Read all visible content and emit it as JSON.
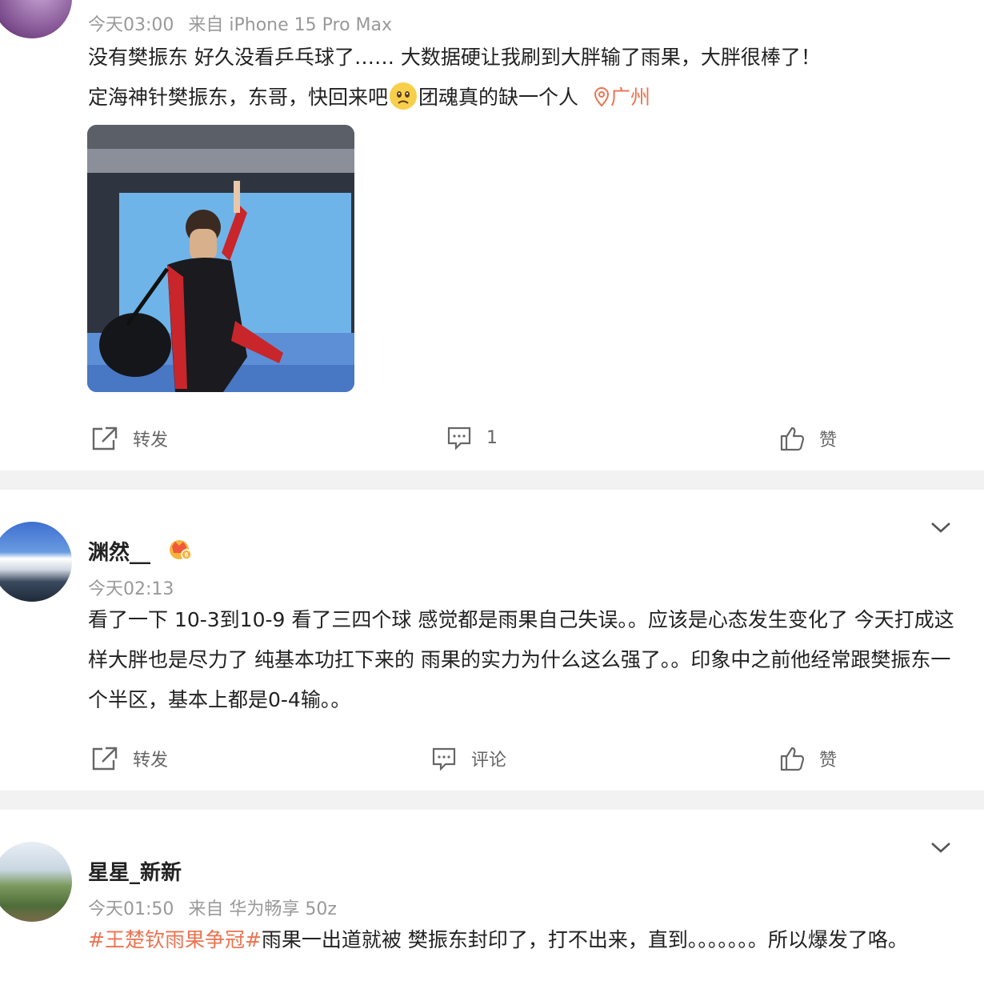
{
  "posts": [
    {
      "time": "今天03:00",
      "source": "来自 iPhone 15 Pro Max",
      "line1": "没有樊振东 好久没看乒乓球了…… 大数据硬让我刷到大胖输了雨果，大胖很棒了！",
      "line2_a": "定海神针樊振东，东哥，快回来吧",
      "line2_b": "团魂真的缺一个人",
      "location": "广州",
      "repost_label": "转发",
      "comment_count": "1",
      "like_label": "赞"
    },
    {
      "username": "渊然__",
      "time": "今天02:13",
      "text": "看了一下 10-3到10-9 看了三四个球 感觉都是雨果自己失误。。应该是心态发生变化了 今天打成这样大胖也是尽力了 纯基本功扛下来的 雨果的实力为什么这么强了。。印象中之前他经常跟樊振东一个半区，基本上都是0-4输。。",
      "repost_label": "转发",
      "comment_label": "评论",
      "like_label": "赞"
    },
    {
      "username": "星星_新新",
      "time": "今天01:50",
      "source": "来自 华为畅享 50z",
      "hashtag": "#王楚钦雨果争冠#",
      "text": "雨果一出道就被 樊振东封印了，打不出来，直到。。。。。。。所以爆发了咯。"
    }
  ],
  "colors": {
    "accent": "#eb7350",
    "meta": "#999999",
    "background": "#f2f2f2"
  },
  "icons": [
    "repost-icon",
    "comment-icon",
    "like-icon",
    "chevron-down-icon",
    "location-pin-icon",
    "crying-emoji-icon",
    "vip-crown-icon"
  ]
}
